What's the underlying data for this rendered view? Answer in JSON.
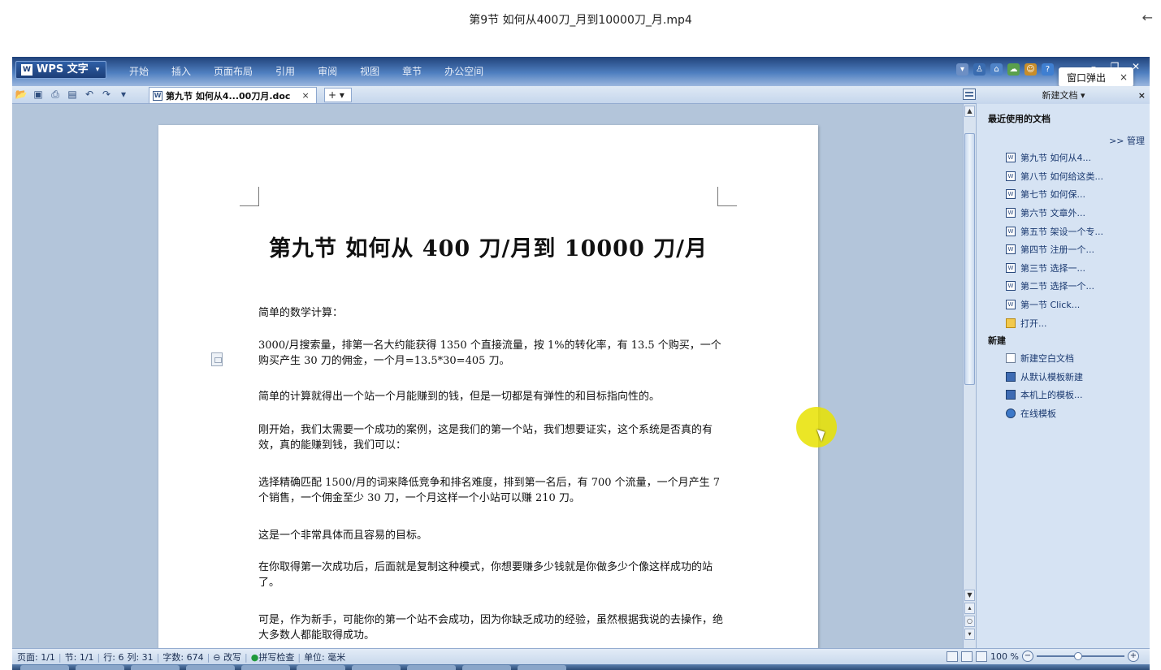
{
  "player": {
    "title": "第9节 如何从400刀_月到10000刀_月.mp4",
    "back_icon": "←"
  },
  "app": {
    "logo_text": "W",
    "button_label": "WPS 文字",
    "menu": [
      "开始",
      "插入",
      "页面布局",
      "引用",
      "审阅",
      "视图",
      "章节",
      "办公空间"
    ],
    "popup_label": "窗口弹出",
    "popup_close": "×"
  },
  "tab": {
    "label": "第九节 如何从4...00刀月.doc",
    "close": "×",
    "new": "+ ▾"
  },
  "document": {
    "title": "第九节  如何从 400 刀/月到 10000 刀/月",
    "paragraphs": [
      "简单的数学计算：",
      "3000/月搜索量，排第一名大约能获得 1350 个直接流量，按 1%的转化率，有 13.5 个购买，一个购买产生 30 刀的佣金，一个月=13.5*30=405 刀。",
      "简单的计算就得出一个站一个月能赚到的钱，但是一切都是有弹性的和目标指向性的。",
      "刚开始，我们太需要一个成功的案例，这是我们的第一个站，我们想要证实，这个系统是否真的有效，真的能赚到钱，我们可以：",
      "选择精确匹配 1500/月的词来降低竞争和排名难度，排到第一名后，有 700 个流量，一个月产生 7 个销售，一个佣金至少 30 刀，一个月这样一个小站可以赚 210 刀。",
      "这是一个非常具体而且容易的目标。",
      "在你取得第一次成功后，后面就是复制这种模式，你想要赚多少钱就是你做多少个像这样成功的站了。",
      "可是，作为新手，可能你的第一个站不会成功，因为你缺乏成功的经验，虽然根据我说的去操作，绝大多数人都能取得成功。"
    ]
  },
  "taskpane": {
    "header": "新建文档 ▾",
    "close": "×",
    "recent_title": "最近使用的文档",
    "manage": ">> 管理",
    "recent": [
      "第九节 如何从4...",
      "第八节 如何给这类...",
      "第七节 如何保...",
      "第六节 文章外...",
      "第五节 架设一个专...",
      "第四节 注册一个...",
      "第三节 选择一...",
      "第二节 选择一个...",
      "第一节 Click...",
      "打开..."
    ],
    "new_title": "新建",
    "new_items": [
      "新建空白文档",
      "从默认模板新建",
      "本机上的模板...",
      "在线模板"
    ]
  },
  "status": {
    "page": "页面: 1/1",
    "section": "节: 1/1",
    "line": "行: 6",
    "col": "列: 31",
    "words": "字数: 674",
    "revise": "改写",
    "spell": "拼写检查",
    "unit": "单位: 毫米",
    "zoom": "100 %"
  }
}
